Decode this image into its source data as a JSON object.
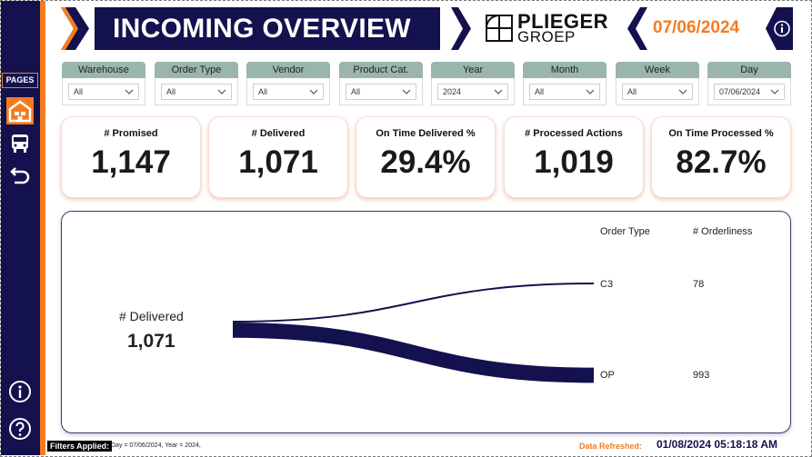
{
  "sidebar": {
    "pages_label": "PAGES",
    "items": [
      {
        "name": "home",
        "icon": "warehouse-icon",
        "active": true
      },
      {
        "name": "transport",
        "icon": "bus-icon",
        "active": false
      },
      {
        "name": "back",
        "icon": "back-arrow-icon",
        "active": false
      }
    ],
    "bottom_icons": [
      "info-icon",
      "help-icon"
    ]
  },
  "header": {
    "title": "INCOMING OVERVIEW",
    "logo_name": "PLIEGER",
    "logo_sub": "GROEP",
    "date": "07/06/2024"
  },
  "filters": [
    {
      "label": "Warehouse",
      "value": "All"
    },
    {
      "label": "Order Type",
      "value": "All"
    },
    {
      "label": "Vendor",
      "value": "All"
    },
    {
      "label": "Product Cat.",
      "value": "All"
    },
    {
      "label": "Year",
      "value": "2024"
    },
    {
      "label": "Month",
      "value": "All"
    },
    {
      "label": "Week",
      "value": "All"
    },
    {
      "label": "Day",
      "value": "07/06/2024"
    }
  ],
  "kpis": [
    {
      "label": "# Promised",
      "value": "1,147"
    },
    {
      "label": "# Delivered",
      "value": "1,071"
    },
    {
      "label": "On Time Delivered %",
      "value": "29.4%"
    },
    {
      "label": "# Processed Actions",
      "value": "1,019"
    },
    {
      "label": "On Time Processed %",
      "value": "82.7%"
    }
  ],
  "flow": {
    "source_label": "# Delivered",
    "source_value": "1,071",
    "col_order_type": "Order Type",
    "col_orderliness": "# Orderliness",
    "rows": [
      {
        "order_type": "C3",
        "count": "78",
        "value": 78
      },
      {
        "order_type": "OP",
        "count": "993",
        "value": 993
      }
    ]
  },
  "footer": {
    "filters_label": "Filters Applied:",
    "filters_text": "Day = 07/06/2024, Year = 2024,",
    "refreshed_label": "Data Refreshed:",
    "refreshed_value": "01/08/2024 05:18:18 AM"
  },
  "colors": {
    "navy": "#13114e",
    "orange": "#f47b20",
    "filter_head": "#9ab5ad"
  }
}
